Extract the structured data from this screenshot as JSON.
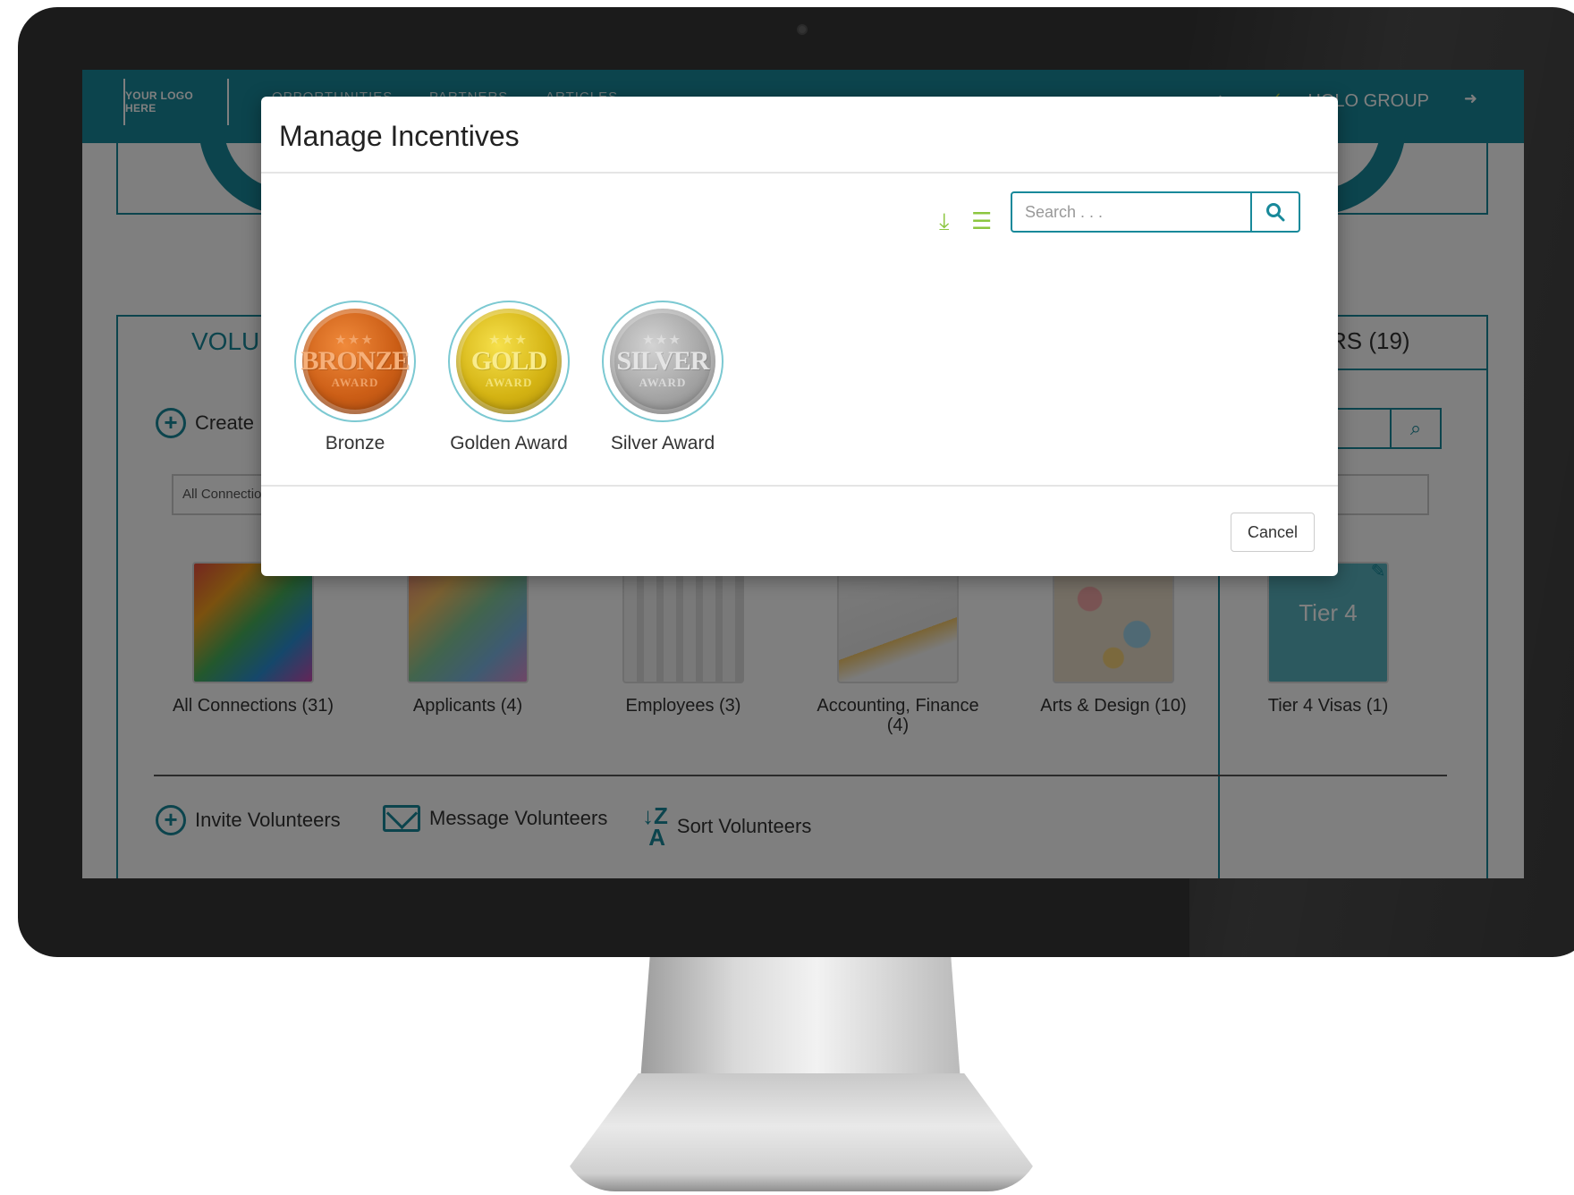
{
  "colors": {
    "brand_teal": "#18899a",
    "accent_green": "#8cc63f",
    "bronze": "#cc5e16",
    "gold": "#d4b313",
    "silver": "#a5a5a5"
  },
  "topbar": {
    "logo_text": "YOUR LOGO HERE",
    "nav": [
      "OPPORTUNITIES",
      "PARTNERS",
      "ARTICLES"
    ],
    "user_name": "HOLO GROUP",
    "icons": [
      "home-icon",
      "check-icon",
      "logout-icon"
    ]
  },
  "background": {
    "panel_title": "VOLUNTEERS",
    "panel_title_right": "RS (19)",
    "create_label": "Create",
    "filter_value": "All Connections",
    "groups": [
      {
        "label": "All Connections (31)"
      },
      {
        "label": "Applicants (4)"
      },
      {
        "label": "Employees (3)"
      },
      {
        "label": "Accounting, Finance (4)"
      },
      {
        "label": "Arts & Design (10)"
      },
      {
        "label": "Tier 4 Visas (1)",
        "thumb_text": "Tier 4"
      }
    ],
    "actions": {
      "invite": "Invite Volunteers",
      "message": "Message Volunteers",
      "sort": "Sort Volunteers"
    }
  },
  "modal": {
    "title": "Manage Incentives",
    "search_placeholder": "Search . . .",
    "toolbar_icons": [
      "download-icon",
      "list-icon"
    ],
    "incentives": [
      {
        "label": "Bronze",
        "medal_text": "BRONZE",
        "medal_sub": "AWARD"
      },
      {
        "label": "Golden Award",
        "medal_text": "GOLD",
        "medal_sub": "AWARD"
      },
      {
        "label": "Silver Award",
        "medal_text": "SILVER",
        "medal_sub": "AWARD"
      }
    ],
    "cancel_label": "Cancel"
  }
}
